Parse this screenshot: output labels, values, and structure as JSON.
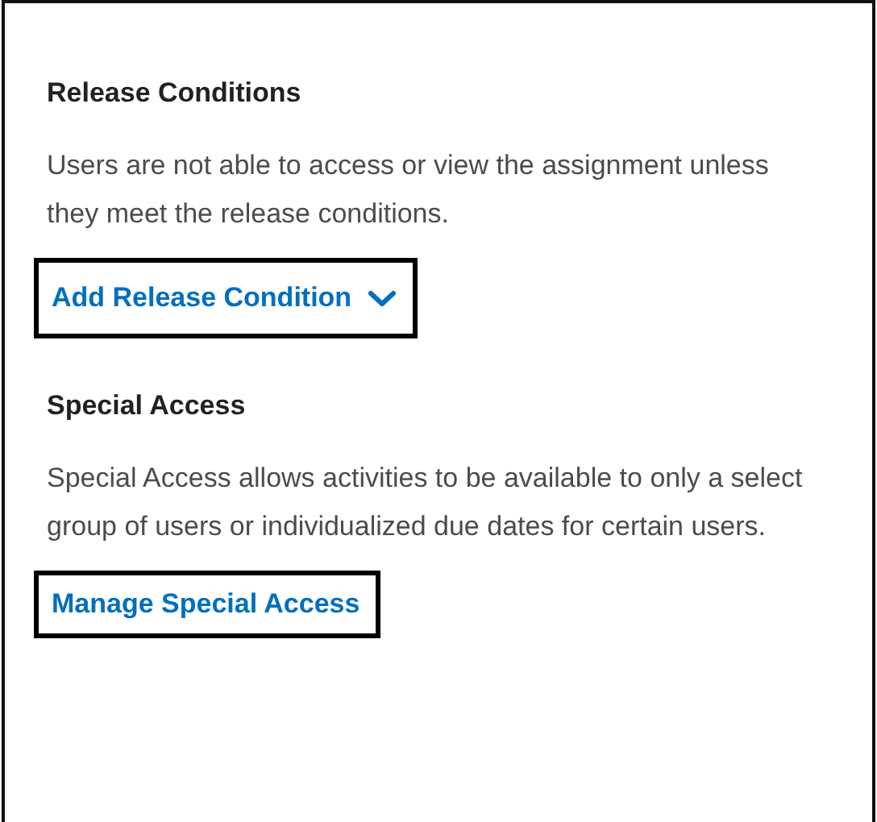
{
  "sections": [
    {
      "heading": "Release Conditions",
      "description": "Users are not able to access or view the assignment unless they meet the release conditions.",
      "link": {
        "label": "Add Release Condition",
        "has_dropdown": true,
        "highlighted": true
      }
    },
    {
      "heading": "Special Access",
      "description": "Special Access allows activities to be available to only a select group of users or individualized due dates for certain users.",
      "link": {
        "label": "Manage Special Access",
        "has_dropdown": false,
        "highlighted": true
      }
    }
  ]
}
